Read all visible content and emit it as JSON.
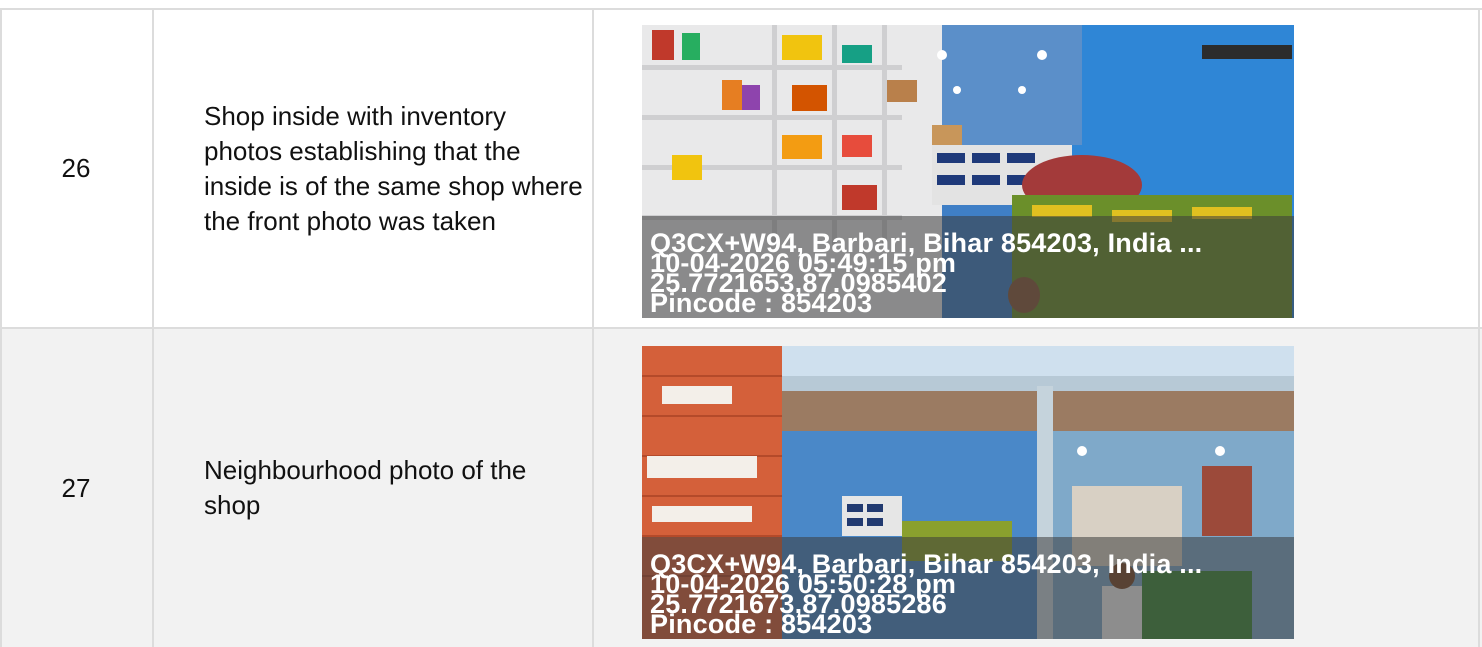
{
  "rows": [
    {
      "number": "26",
      "description": "Shop inside with inventory photos establishing that the inside is of the same shop where the front photo was taken",
      "geotag": {
        "address": "Q3CX+W94, Barbari, Bihar 854203, India ...",
        "datetime": "10-04-2026 05:49:15 pm",
        "coordinates": "25.7721653,87.0985402",
        "pincode": "Pincode : 854203"
      }
    },
    {
      "number": "27",
      "description": "Neighbourhood photo of the shop",
      "geotag": {
        "address": "Q3CX+W94, Barbari, Bihar 854203, India ...",
        "datetime": "10-04-2026 05:50:28 pm",
        "coordinates": "25.7721673,87.0985286",
        "pincode": "Pincode : 854203"
      }
    }
  ]
}
